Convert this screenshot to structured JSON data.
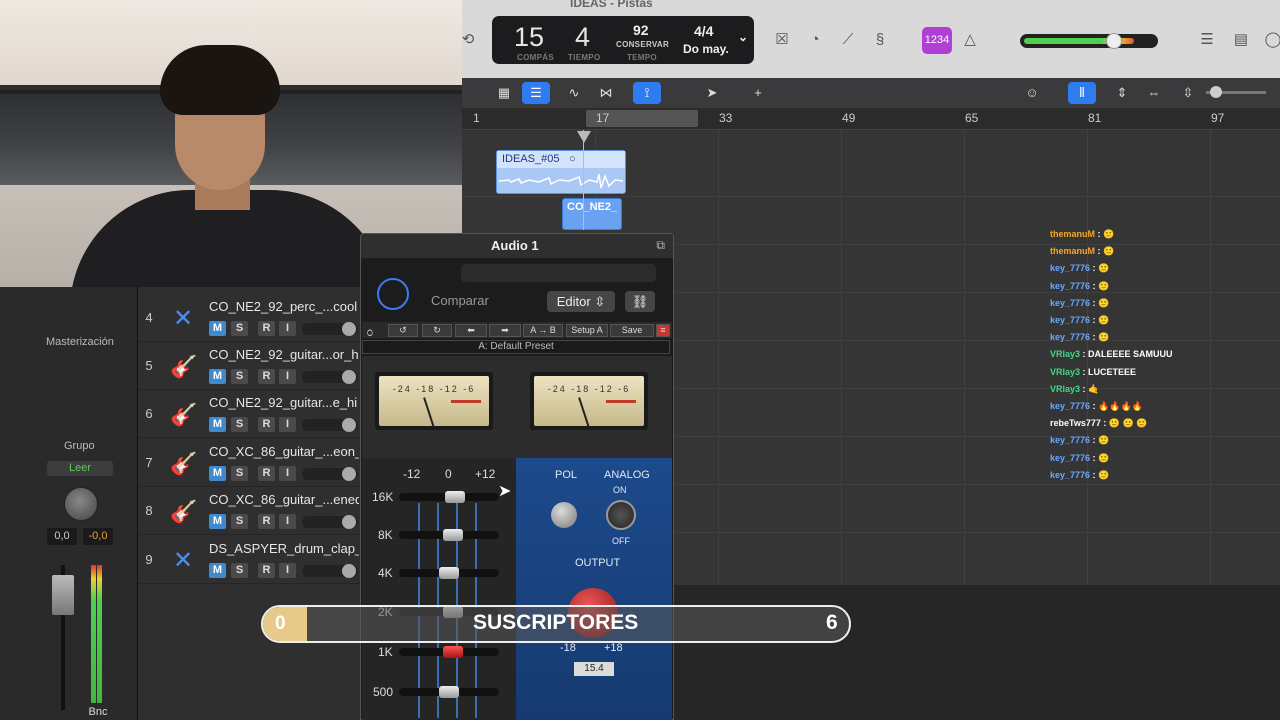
{
  "window": {
    "title": "IDEAS - Pistas"
  },
  "lcd": {
    "bars": "15",
    "beat": "4",
    "bars_label": "COMPÁS",
    "beat_label": "TIEMPO",
    "tempo": "92",
    "tempo_mode": "CONSERVAR",
    "tempo_label": "TEMPO",
    "time_sig": "4/4",
    "key": "Do may."
  },
  "toolbar": {
    "count_in": "1234"
  },
  "ruler": {
    "marks": [
      "1",
      "17",
      "33",
      "49",
      "65",
      "81",
      "97"
    ]
  },
  "regions": [
    {
      "name": "IDEAS_#05"
    },
    {
      "name": "CO_NE2_"
    }
  ],
  "left_panel": {
    "mastering": "Masterización",
    "group": "Grupo",
    "read": "Leer",
    "val1": "0,0",
    "val2": "-0,0",
    "bnc": "Bnc"
  },
  "tracks": [
    {
      "num": "4",
      "name": "CO_NE2_92_perc_...cool",
      "icon": "x-icon"
    },
    {
      "num": "5",
      "name": "CO_NE2_92_guitar...or_h",
      "icon": "guitar-icon"
    },
    {
      "num": "6",
      "name": "CO_NE2_92_guitar...e_hi",
      "icon": "guitar-icon"
    },
    {
      "num": "7",
      "name": "CO_XC_86_guitar_...eon_",
      "icon": "guitar-icon"
    },
    {
      "num": "8",
      "name": "CO_XC_86_guitar_...ened",
      "icon": "guitar-icon"
    },
    {
      "num": "9",
      "name": "DS_ASPYER_drum_clap_",
      "icon": "x-icon"
    }
  ],
  "track_buttons": {
    "m": "M",
    "s": "S",
    "r": "R",
    "i": "I"
  },
  "plugin": {
    "title": "Audio 1",
    "compare": "Comparar",
    "editor": "Editor",
    "waves_buttons": [
      "A → B",
      "Setup A",
      "Save"
    ],
    "preset_name": "A: Default Preset",
    "vu_scale": "-24 -18 -12 -6",
    "eq_scale": [
      "-12",
      "0",
      "+12"
    ],
    "eq_bands": [
      "16K",
      "8K",
      "4K",
      "2K",
      "1K",
      "500"
    ],
    "pol": "POL",
    "analog": "ANALOG",
    "on": "ON",
    "off": "OFF",
    "output": "OUTPUT",
    "out_min": "-18",
    "out_max": "+18",
    "out_value": "15.4"
  },
  "subscribers": {
    "start": "0",
    "label": "SUSCRIPTORES",
    "goal": "6"
  },
  "chat": [
    {
      "user": "themanuM",
      "msg": "🙂",
      "color": "#f5a623"
    },
    {
      "user": "themanuM",
      "msg": "🙂",
      "color": "#f5a623"
    },
    {
      "user": "key_7776",
      "msg": "🙂",
      "color": "#6aa8ff"
    },
    {
      "user": "key_7776",
      "msg": "🙂",
      "color": "#6aa8ff"
    },
    {
      "user": "key_7776",
      "msg": "🙂",
      "color": "#6aa8ff"
    },
    {
      "user": "key_7776",
      "msg": "🙂",
      "color": "#6aa8ff"
    },
    {
      "user": "key_7776",
      "msg": "🙂",
      "color": "#6aa8ff"
    },
    {
      "user": "VRlay3",
      "msg": "DALEEEE SAMUUU",
      "color": "#3ddc84"
    },
    {
      "user": "VRlay3",
      "msg": "LUCETEEE",
      "color": "#3ddc84"
    },
    {
      "user": "VRlay3",
      "msg": "🤙",
      "color": "#3ddc84"
    },
    {
      "user": "key_7776",
      "msg": "🔥🔥🔥🔥",
      "color": "#6aa8ff"
    },
    {
      "user": "rebeTws777",
      "msg": "🙂 🙂 🙂",
      "color": "#ffffff"
    },
    {
      "user": "key_7776",
      "msg": "🙂",
      "color": "#6aa8ff"
    },
    {
      "user": "key_7776",
      "msg": "🙂",
      "color": "#6aa8ff"
    },
    {
      "user": "key_7776",
      "msg": "🙂",
      "color": "#6aa8ff"
    }
  ]
}
